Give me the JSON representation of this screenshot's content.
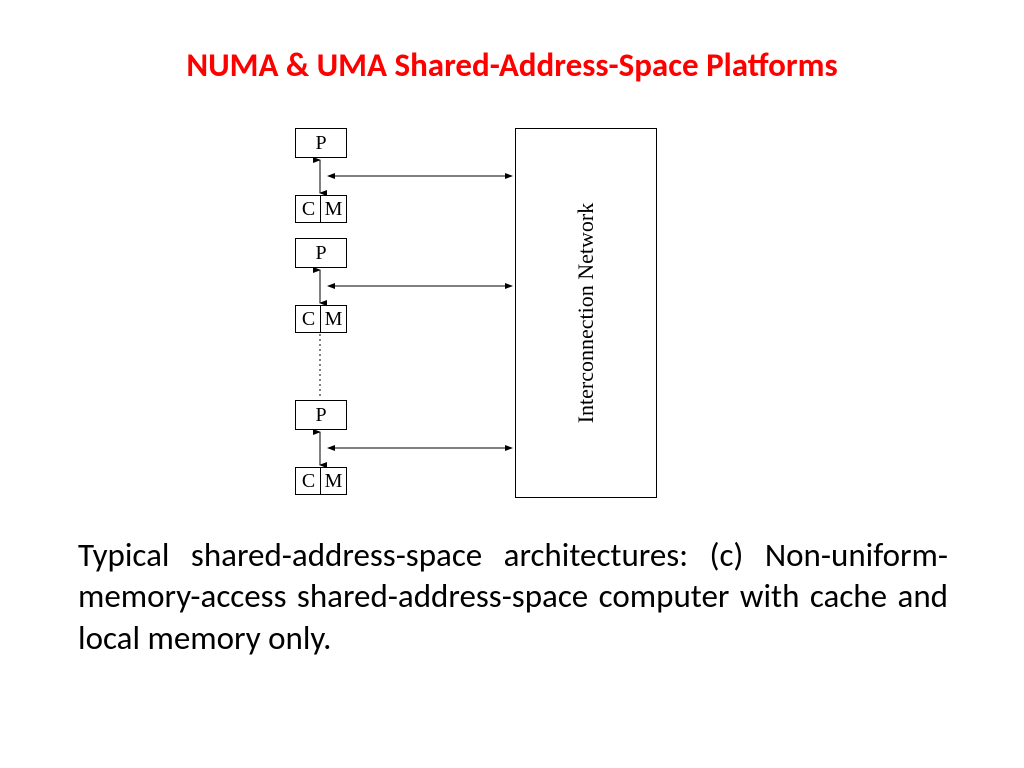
{
  "title": "NUMA & UMA Shared-Address-Space Platforms",
  "diagram": {
    "node_label_p": "P",
    "node_label_c": "C",
    "node_label_m": "M",
    "network_label": "Interconnection Network"
  },
  "caption": "Typical shared-address-space architectures: (c) Non-uniform-memory-access shared-address-space computer with cache and local memory only."
}
